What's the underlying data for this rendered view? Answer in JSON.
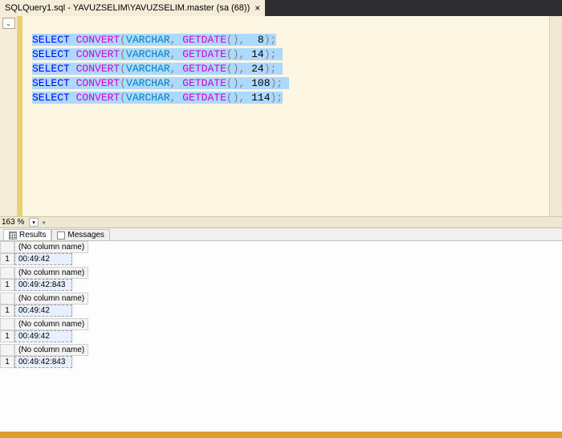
{
  "tab": {
    "title": "SQLQuery1.sql - YAVUZSELIM\\YAVUZSELIM.master (sa (68))",
    "close": "×"
  },
  "editor": {
    "dropdown_glyph": "⌄",
    "lines": [
      {
        "kw": "SELECT",
        "fn": "CONVERT",
        "ty": "VARCHAR",
        "fn2": "GETDATE",
        "num": "8"
      },
      {
        "kw": "SELECT",
        "fn": "CONVERT",
        "ty": "VARCHAR",
        "fn2": "GETDATE",
        "num": "14"
      },
      {
        "kw": "SELECT",
        "fn": "CONVERT",
        "ty": "VARCHAR",
        "fn2": "GETDATE",
        "num": "24"
      },
      {
        "kw": "SELECT",
        "fn": "CONVERT",
        "ty": "VARCHAR",
        "fn2": "GETDATE",
        "num": "108"
      },
      {
        "kw": "SELECT",
        "fn": "CONVERT",
        "ty": "VARCHAR",
        "fn2": "GETDATE",
        "num": "114"
      }
    ]
  },
  "zoom": {
    "value": "163 %"
  },
  "results_tabs": {
    "results": "Results",
    "messages": "Messages"
  },
  "results": [
    {
      "col": "(No column name)",
      "rownum": "1",
      "val": "00:49:42"
    },
    {
      "col": "(No column name)",
      "rownum": "1",
      "val": "00:49:42:843"
    },
    {
      "col": "(No column name)",
      "rownum": "1",
      "val": "00:49:42"
    },
    {
      "col": "(No column name)",
      "rownum": "1",
      "val": "00:49:42"
    },
    {
      "col": "(No column name)",
      "rownum": "1",
      "val": "00:49:42:843"
    }
  ]
}
